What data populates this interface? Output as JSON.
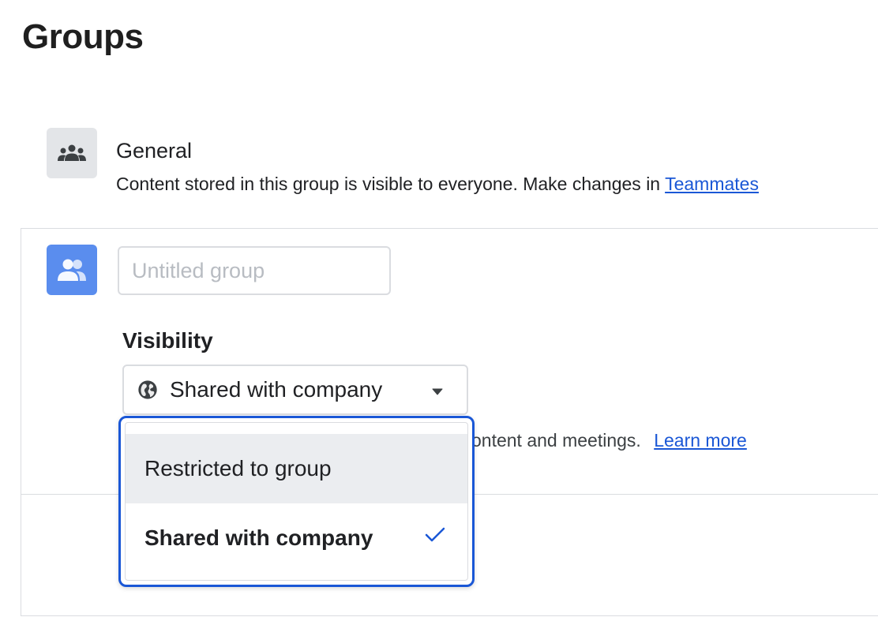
{
  "page": {
    "title": "Groups"
  },
  "general_group": {
    "name": "General",
    "description": "Content stored in this group is visible to everyone. Make changes in",
    "link_text": "Teammates",
    "icon": "people-group-icon"
  },
  "new_group": {
    "icon": "people-icon",
    "name_placeholder": "Untitled group",
    "name_value": "",
    "visibility_label": "Visibility",
    "visibility_selected": "Shared with company",
    "visibility_icon": "globe-icon",
    "helper_text": "ontent and meetings.",
    "helper_link": "Learn more"
  },
  "visibility_menu": {
    "options": [
      {
        "label": "Restricted to group",
        "selected": false,
        "hovered": true
      },
      {
        "label": "Shared with company",
        "selected": true,
        "hovered": false
      }
    ]
  },
  "colors": {
    "accent": "#1a57d6",
    "avatar_blue": "#5a8dee",
    "avatar_gray": "#e3e5e8",
    "hover_bg": "#ebedf0"
  }
}
